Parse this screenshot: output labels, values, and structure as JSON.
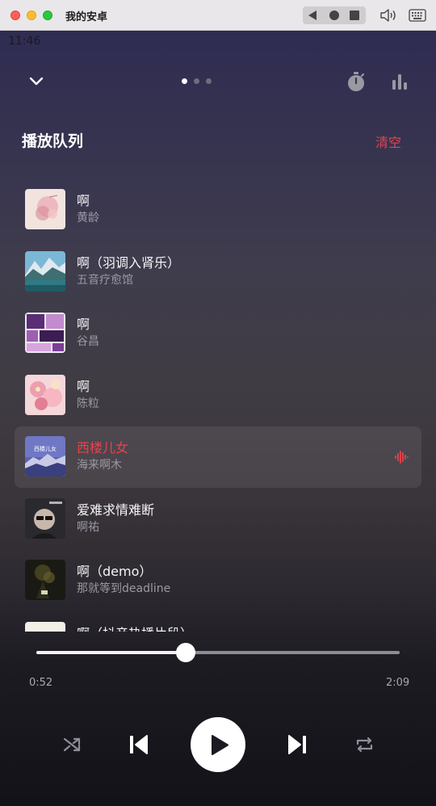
{
  "window": {
    "title": "我的安卓"
  },
  "status": {
    "time": "11:46"
  },
  "pager": {
    "count": 3,
    "active": 0
  },
  "queue": {
    "title": "播放队列",
    "clear_label": "清空",
    "items": [
      {
        "title": "啊",
        "artist": "黄龄",
        "cover": "pink-watercolor",
        "playing": false
      },
      {
        "title": "啊（羽调入肾乐）",
        "artist": "五音疗愈馆",
        "cover": "mountain-lake",
        "playing": false
      },
      {
        "title": "啊",
        "artist": "谷昌",
        "cover": "purple-collage",
        "playing": false
      },
      {
        "title": "啊",
        "artist": "陈粒",
        "cover": "pink-flowers",
        "playing": false
      },
      {
        "title": "西楼儿女",
        "artist": "海来啊木",
        "cover": "blue-night-mountains",
        "playing": true
      },
      {
        "title": "爱难求情难断",
        "artist": "啊祐",
        "cover": "man-sunglasses",
        "playing": false
      },
      {
        "title": "啊（demo）",
        "artist": "那就等到deadline",
        "cover": "dark-figure",
        "playing": false
      },
      {
        "title": "啊（抖音热播片段）",
        "artist": "",
        "cover": "light-partial",
        "playing": false
      }
    ]
  },
  "player": {
    "current_time": "0:52",
    "total_time": "2:09",
    "progress": 0.41
  },
  "colors": {
    "accent": "#e8424e"
  },
  "icons": [
    "collapse-chevron-icon",
    "sleep-timer-icon",
    "equalizer-icon",
    "shuffle-icon",
    "previous-icon",
    "play-icon",
    "next-icon",
    "repeat-icon",
    "now-playing-wave-icon"
  ]
}
